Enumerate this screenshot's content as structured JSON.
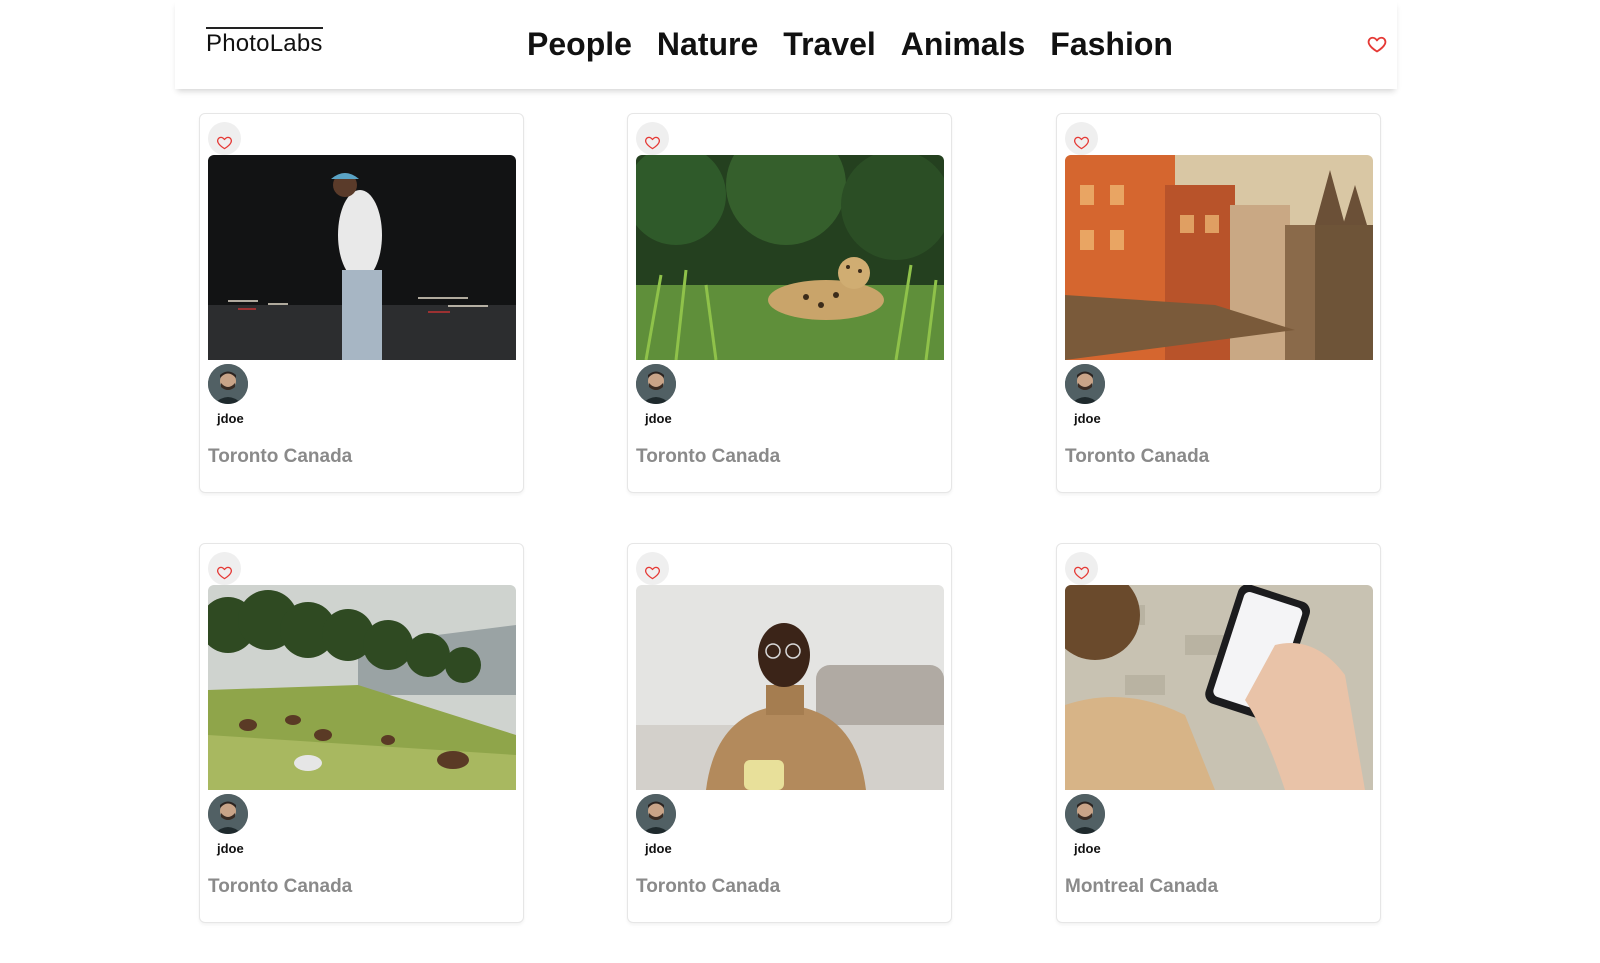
{
  "nav": {
    "logo": "PhotoLabs",
    "topics": [
      "People",
      "Nature",
      "Travel",
      "Animals",
      "Fashion"
    ],
    "fav_icon": "heart-outline-icon"
  },
  "colors": {
    "accent": "#e53935",
    "location_text": "#8a8a8a",
    "fav_bg": "#efefef"
  },
  "photos": [
    {
      "username": "jdoe",
      "location": "Toronto Canada",
      "image": "man-walking-night-street"
    },
    {
      "username": "jdoe",
      "location": "Toronto Canada",
      "image": "jaguar-in-grass"
    },
    {
      "username": "jdoe",
      "location": "Toronto Canada",
      "image": "orange-buildings-street"
    },
    {
      "username": "jdoe",
      "location": "Toronto Canada",
      "image": "horses-grazing-hillside"
    },
    {
      "username": "jdoe",
      "location": "Toronto Canada",
      "image": "man-smiling-with-mug"
    },
    {
      "username": "jdoe",
      "location": "Montreal Canada",
      "image": "hand-holding-phone"
    }
  ]
}
